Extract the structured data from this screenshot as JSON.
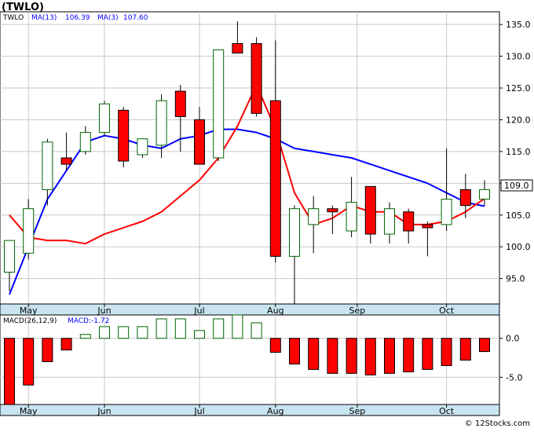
{
  "title": "(TWLO)",
  "watermark": "© 12Stocks.com",
  "main_panel": {
    "ticker": "TWLO",
    "ma13_label": "MA(13)",
    "ma13_value": "106.39",
    "ma3_label": "MA(3)",
    "ma3_value": "107.60",
    "last_price_tag": "109.0"
  },
  "macd_panel": {
    "label": "MACD(26,12,9)",
    "value_label": "MACD:-1.72"
  },
  "colors": {
    "up_candle": "#006400",
    "down_candle": "#ff0000",
    "ma13_line": "#0000ff",
    "ma3_line": "#ff0000",
    "grid": "#c8c8c8",
    "axis_band": "#c8e4f0"
  },
  "chart_data": [
    {
      "type": "candlestick",
      "ylim": [
        91,
        137
      ],
      "y_ticks": [
        95,
        100,
        105,
        110,
        115,
        120,
        125,
        130,
        135
      ],
      "y_tick_labels": [
        "95.0",
        "100.0",
        "105.0",
        "110.0",
        "115.0",
        "120.0",
        "125.0",
        "130.0",
        "135.0"
      ],
      "x_labels": [
        "May",
        "Jun",
        "Jul",
        "Aug",
        "Sep",
        "Oct"
      ],
      "candles": [
        {
          "o": 96.0,
          "h": 101.0,
          "l": 93.0,
          "c": 101.0
        },
        {
          "o": 99.0,
          "h": 107.5,
          "l": 98.0,
          "c": 106.0
        },
        {
          "o": 109.0,
          "h": 117.0,
          "l": 106.5,
          "c": 116.5
        },
        {
          "o": 114.0,
          "h": 118.0,
          "l": 112.0,
          "c": 113.0
        },
        {
          "o": 115.0,
          "h": 119.0,
          "l": 114.5,
          "c": 118.0
        },
        {
          "o": 118.0,
          "h": 123.0,
          "l": 117.5,
          "c": 122.5
        },
        {
          "o": 121.5,
          "h": 122.0,
          "l": 112.5,
          "c": 113.5
        },
        {
          "o": 114.5,
          "h": 117.0,
          "l": 114.0,
          "c": 117.0
        },
        {
          "o": 116.0,
          "h": 124.0,
          "l": 114.0,
          "c": 123.0
        },
        {
          "o": 124.5,
          "h": 125.5,
          "l": 115.0,
          "c": 120.5
        },
        {
          "o": 120.0,
          "h": 122.0,
          "l": 114.5,
          "c": 113.0
        },
        {
          "o": 114.0,
          "h": 131.0,
          "l": 113.5,
          "c": 131.0
        },
        {
          "o": 132.0,
          "h": 135.5,
          "l": 130.5,
          "c": 130.5
        },
        {
          "o": 132.0,
          "h": 133.0,
          "l": 120.5,
          "c": 121.0
        },
        {
          "o": 123.0,
          "h": 132.5,
          "l": 97.5,
          "c": 98.5
        },
        {
          "o": 98.5,
          "h": 106.5,
          "l": 91.0,
          "c": 106.0
        },
        {
          "o": 103.5,
          "h": 108.0,
          "l": 99.0,
          "c": 106.0
        },
        {
          "o": 106.0,
          "h": 106.5,
          "l": 102.0,
          "c": 105.5
        },
        {
          "o": 102.5,
          "h": 111.0,
          "l": 101.5,
          "c": 107.0
        },
        {
          "o": 109.5,
          "h": 109.5,
          "l": 100.5,
          "c": 102.0
        },
        {
          "o": 102.0,
          "h": 107.0,
          "l": 100.5,
          "c": 106.0
        },
        {
          "o": 105.5,
          "h": 106.0,
          "l": 100.5,
          "c": 102.5
        },
        {
          "o": 103.5,
          "h": 104.0,
          "l": 98.5,
          "c": 103.0
        },
        {
          "o": 103.5,
          "h": 115.5,
          "l": 102.5,
          "c": 107.5
        },
        {
          "o": 109.0,
          "h": 111.5,
          "l": 104.5,
          "c": 106.5
        },
        {
          "o": 107.5,
          "h": 110.5,
          "l": 106.5,
          "c": 109.0
        }
      ],
      "series": [
        {
          "name": "MA(13)",
          "points": [
            [
              0,
              92.5
            ],
            [
              1,
              100.0
            ],
            [
              2,
              107.5
            ],
            [
              3,
              112.0
            ],
            [
              4,
              116.5
            ],
            [
              5,
              117.5
            ]
          ]
        },
        {
          "name": "MA(3)",
          "points": [
            [
              0,
              105.0
            ],
            [
              1,
              101.5
            ],
            [
              2,
              101.0
            ],
            [
              4,
              100.5
            ],
            [
              5,
              102.5
            ]
          ]
        }
      ],
      "ma13_full": [
        92.5,
        100.0,
        107.5,
        112.0,
        116.5,
        117.5,
        117.0,
        116.0,
        115.5,
        117.0,
        117.5,
        118.5,
        118.5,
        118.0,
        117.0,
        115.5,
        115.0,
        114.5,
        114.0,
        113.0,
        112.0,
        111.0,
        110.0,
        108.5,
        107.0,
        106.4
      ],
      "ma3_full": [
        105.0,
        101.5,
        101.0,
        101.0,
        100.5,
        102.0,
        103.0,
        104.0,
        105.5,
        108.0,
        110.5,
        114.0,
        119.0,
        125.5,
        118.5,
        108.5,
        103.5,
        104.5,
        106.5,
        105.5,
        105.5,
        103.5,
        103.5,
        104.0,
        105.5,
        107.6
      ]
    },
    {
      "type": "bar",
      "ylim": [
        -8.5,
        3.0
      ],
      "y_ticks": [
        0,
        -5
      ],
      "y_tick_labels": [
        "0.0",
        "-5.0"
      ],
      "x_labels": [
        "May",
        "Jun",
        "Jul",
        "Aug",
        "Sep",
        "Oct"
      ],
      "values": [
        -9.0,
        -6.0,
        -3.0,
        -1.5,
        0.5,
        1.5,
        1.5,
        1.5,
        2.5,
        2.5,
        1.0,
        2.5,
        3.0,
        2.0,
        -1.8,
        -3.3,
        -4.0,
        -4.5,
        -4.5,
        -4.7,
        -4.5,
        -4.3,
        -4.0,
        -3.5,
        -2.8,
        -1.7
      ]
    }
  ]
}
